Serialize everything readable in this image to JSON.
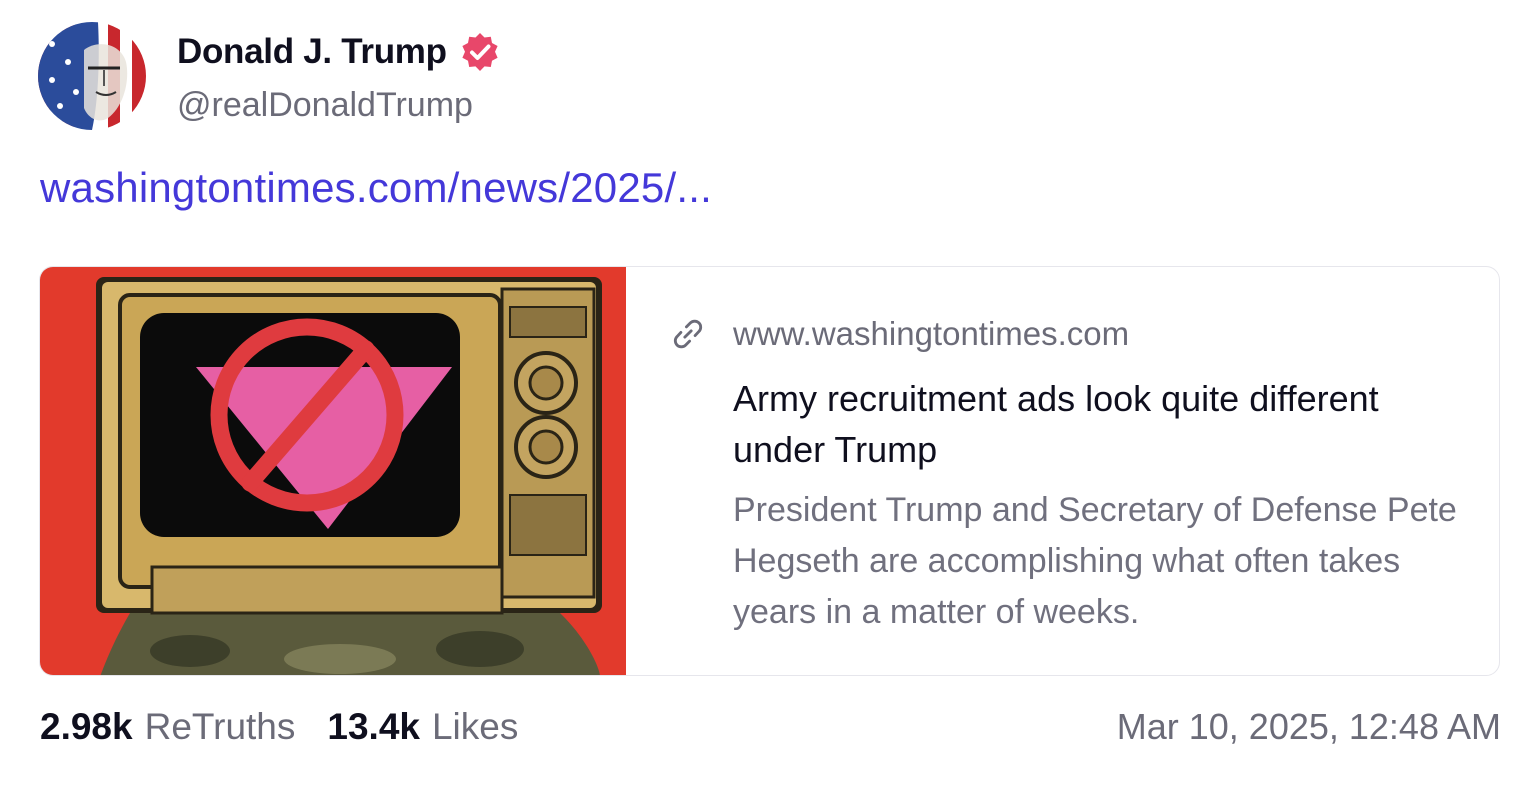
{
  "author": {
    "name": "Donald J. Trump",
    "handle": "@realDonaldTrump",
    "verified": true,
    "verified_badge_color": "#e8476a"
  },
  "post": {
    "link_text": "washingtontimes.com/news/2025/..."
  },
  "link_card": {
    "domain": "www.washingtontimes.com",
    "title": "Army recruitment ads look quite different under Trump",
    "description": "President Trump and Secretary of Defense Pete Hegseth are accomplishing what often takes years in a matter of weeks.",
    "icon": "link-icon"
  },
  "stats": {
    "retruths_count": "2.98k",
    "retruths_label": "ReTruths",
    "likes_count": "13.4k",
    "likes_label": "Likes"
  },
  "timestamp": "Mar 10, 2025, 12:48 AM",
  "colors": {
    "link": "#4438d9",
    "text_primary": "#0f0f1e",
    "text_secondary": "#6b6b78",
    "card_border": "#e6e6ec"
  }
}
